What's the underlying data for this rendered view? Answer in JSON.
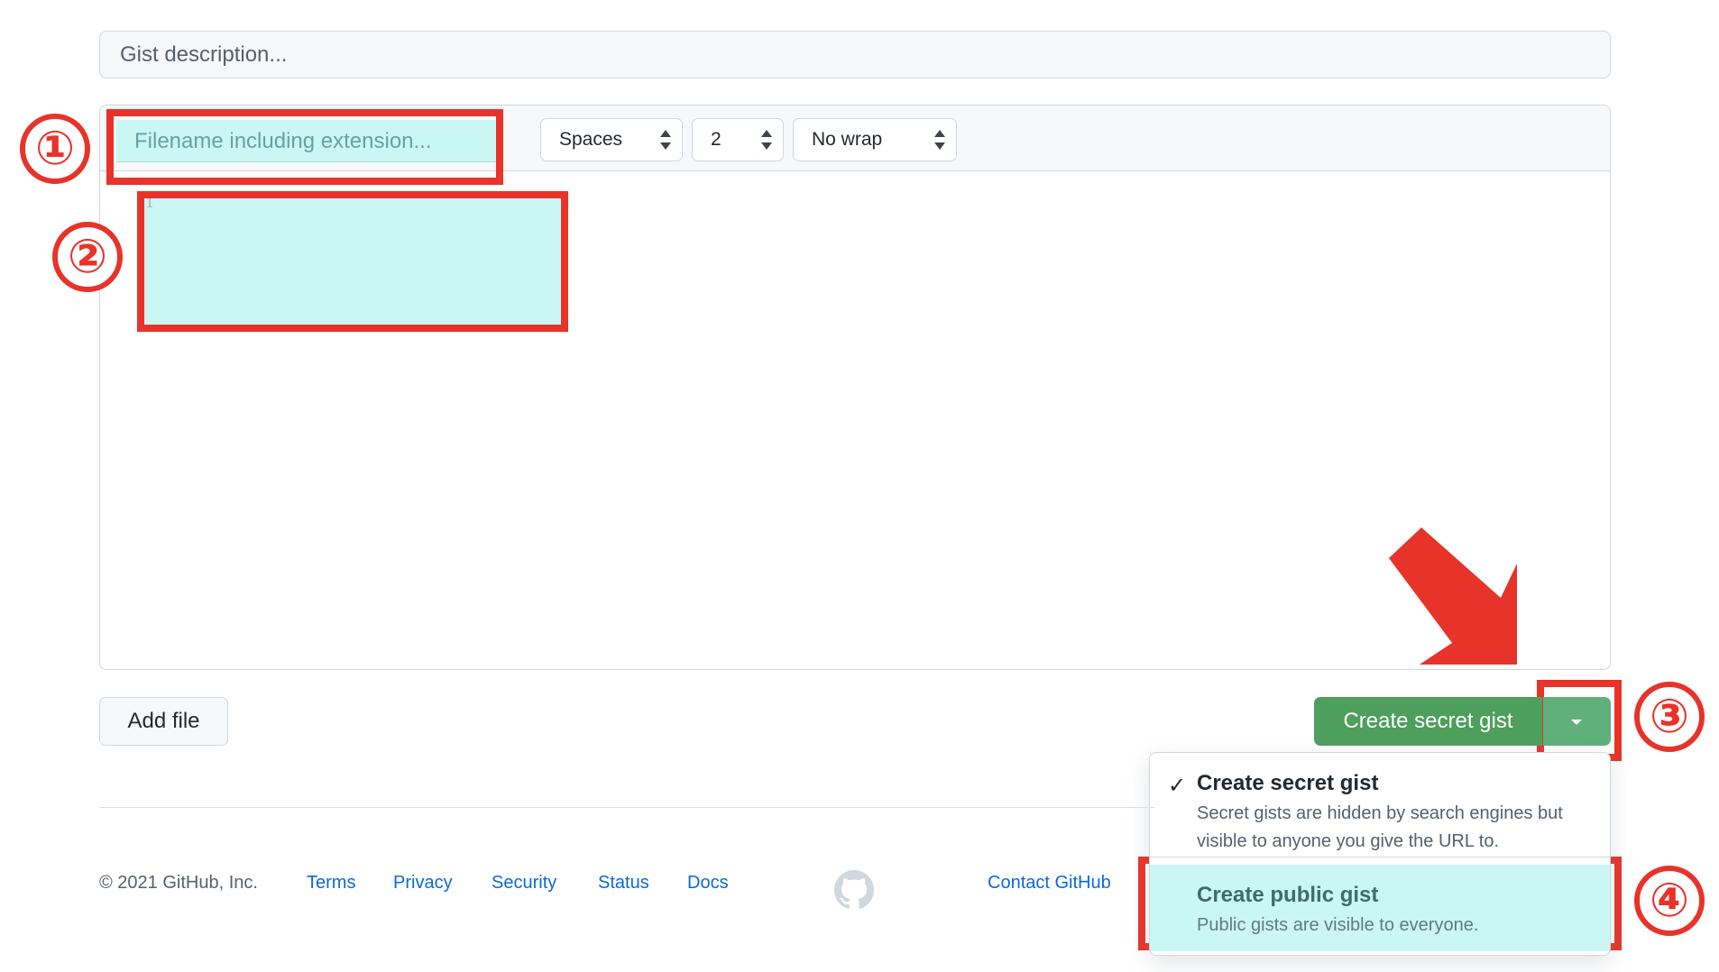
{
  "gist": {
    "description_placeholder": "Gist description...",
    "filename_placeholder": "Filename including extension...",
    "indent_mode": "Spaces",
    "indent_size": "2",
    "wrap_mode": "No wrap",
    "line_number": "1"
  },
  "actions": {
    "add_file_label": "Add file",
    "create_label": "Create secret gist"
  },
  "menu": {
    "items": [
      {
        "title": "Create secret gist",
        "desc": "Secret gists are hidden by search engines but visible to anyone you give the URL to.",
        "checked": true
      },
      {
        "title": "Create public gist",
        "desc": "Public gists are visible to everyone.",
        "checked": false
      }
    ]
  },
  "annotations": {
    "n1": "①",
    "n2": "②",
    "n3": "③",
    "n4": "④",
    "color": "#e8332a"
  },
  "footer": {
    "copyright": "© 2021 GitHub, Inc.",
    "links": [
      "Terms",
      "Privacy",
      "Security",
      "Status",
      "Docs",
      "Contact GitHub"
    ]
  },
  "colors": {
    "accent_green": "#4e9f5c",
    "highlight": "#caf6f3",
    "link": "#0969da"
  }
}
